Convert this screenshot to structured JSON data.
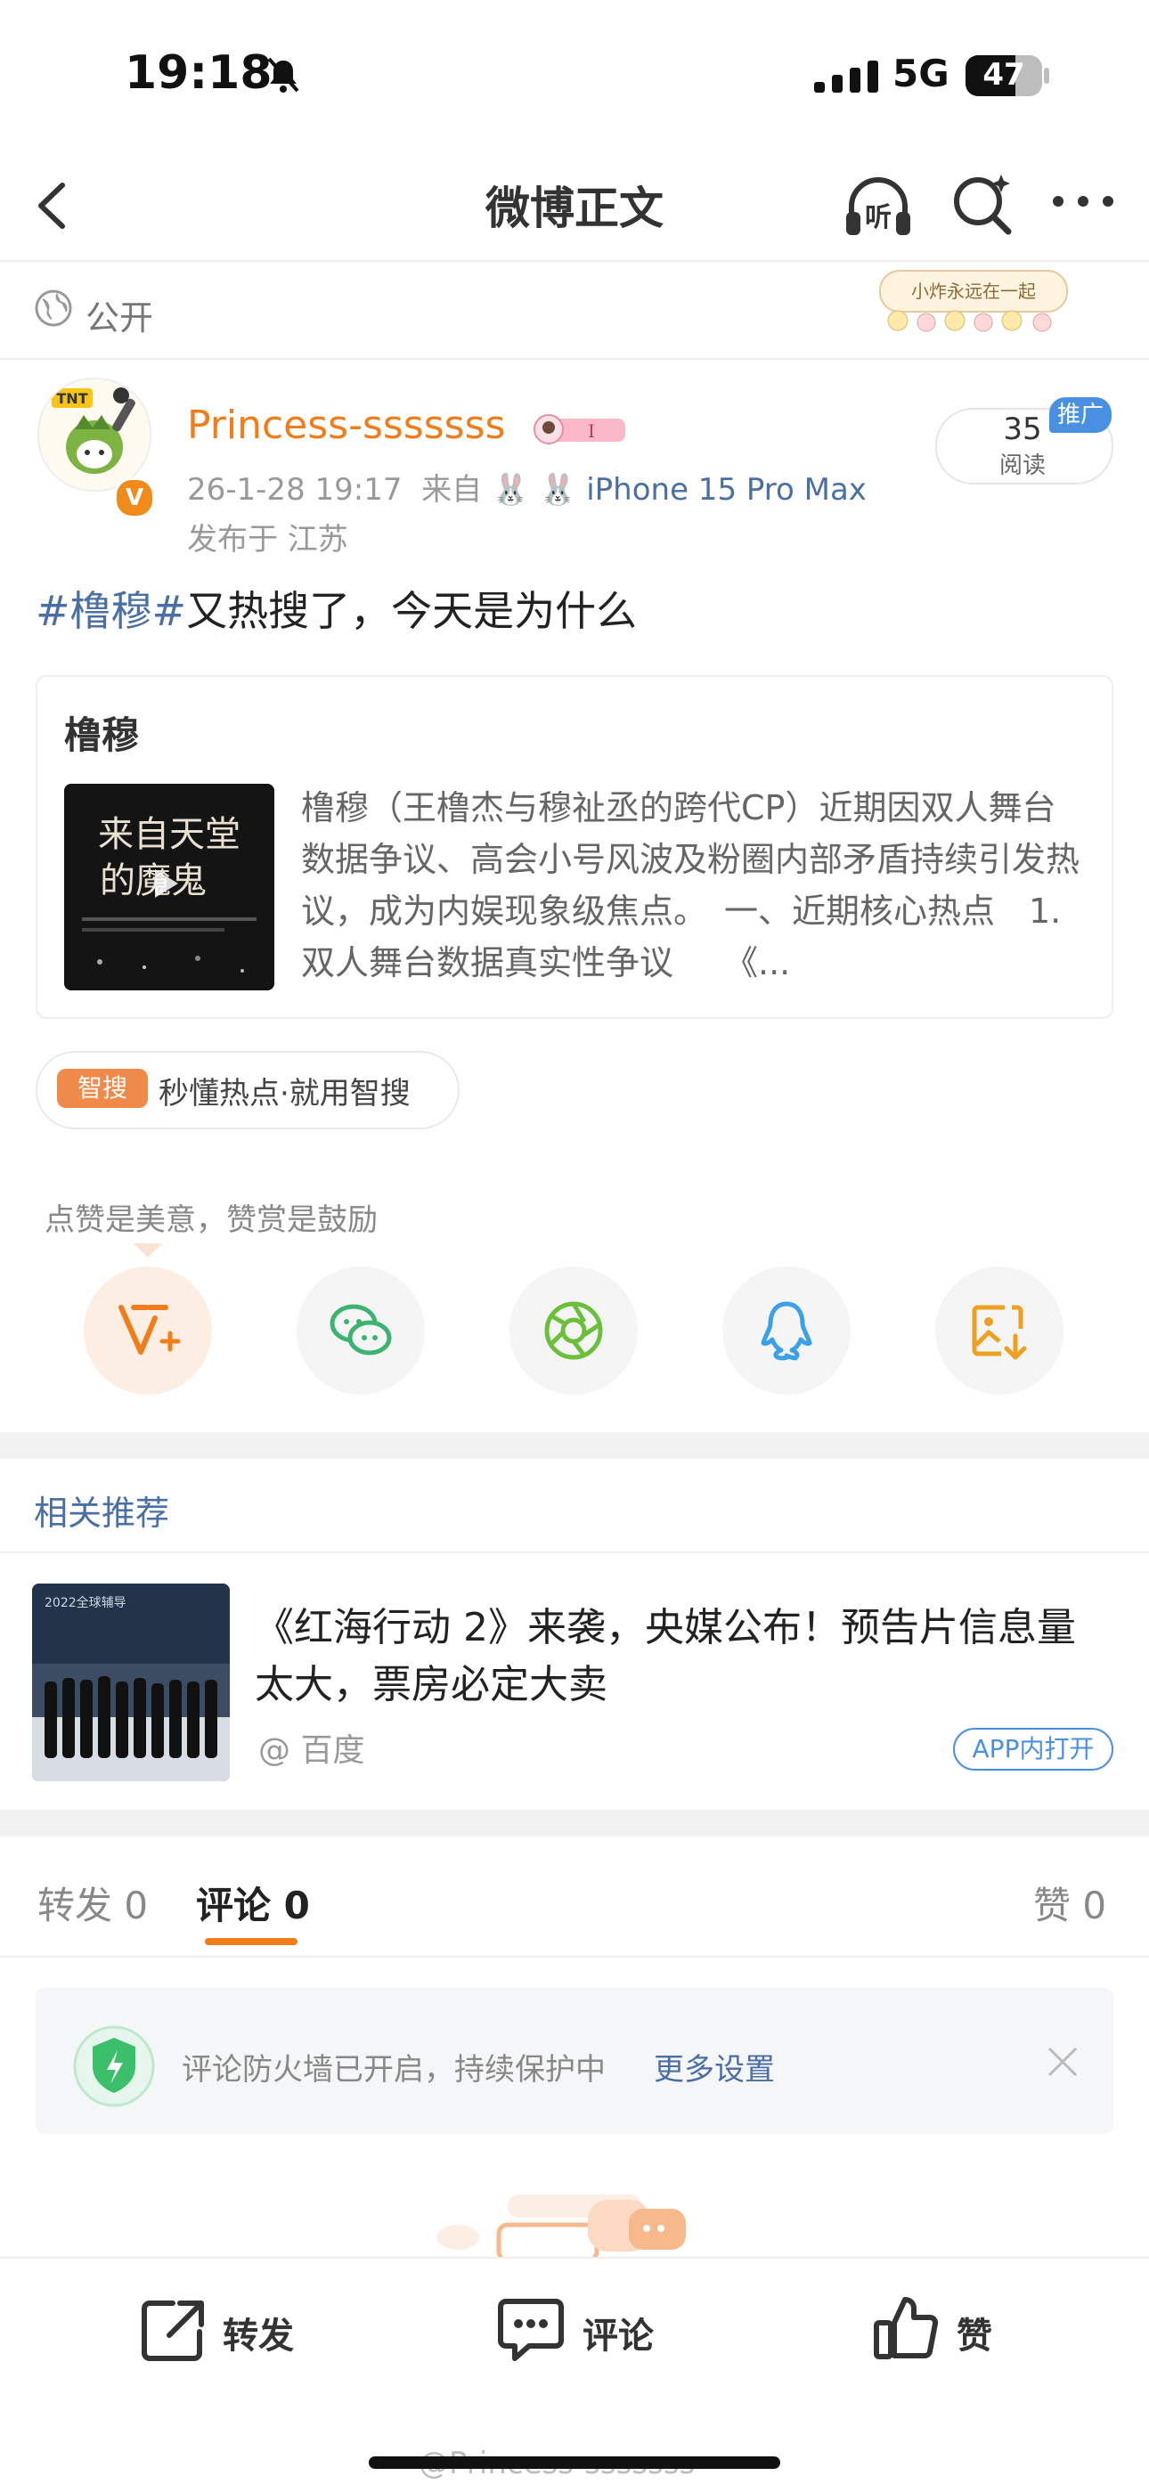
{
  "status_bar": {
    "time": "19:18",
    "network": "5G",
    "battery": "47"
  },
  "nav": {
    "title": "微博正文"
  },
  "visibility": {
    "label": "公开",
    "sticker_text": "小炸永远在一起"
  },
  "post": {
    "username": "Princess-sssssss",
    "badge_text": "I",
    "meta_time": "26-1-28 19:17",
    "meta_from": "来自",
    "device": "iPhone 15 Pro Max",
    "location": "发布于 江苏",
    "reads": "35",
    "reads_label": "阅读",
    "promo": "推广",
    "hashtag": "#橹穆#",
    "text": "又热搜了，今天是为什么"
  },
  "card": {
    "title": "橹穆",
    "image_title": "来自天堂的魔鬼",
    "description": "橹穆（王橹杰与穆祉丞的跨代CP）近期因双人舞台数据争议、高会小号风波及粉圈内部矛盾持续引发热议，成为内娱现象级焦点。　一、近期核心热点　1. 双人舞台数据真实性争议　　《..."
  },
  "smart_search": {
    "tag": "智搜",
    "text": "秒懂热点·就用智搜"
  },
  "like_hint": "点赞是美意，赞赏是鼓励",
  "share_icons": [
    "v-plus-icon",
    "wechat-icon",
    "moments-icon",
    "qq-icon",
    "save-image-icon"
  ],
  "related": {
    "section_title": "相关推荐",
    "title": "《红海行动 2》来袭，央媒公布！预告片信息量太大，票房必定大卖",
    "source": "@ 百度",
    "open_label": "APP内打开"
  },
  "tabs": {
    "repost": "转发 0",
    "comment": "评论 0",
    "like": "赞 0"
  },
  "firewall": {
    "text": "评论防火墙已开启，持续保护中",
    "link": "更多设置"
  },
  "bottom_bar": {
    "repost": "转发",
    "comment": "评论",
    "like": "赞"
  },
  "watermark": "@Princess-sssssss",
  "colors": {
    "accent": "#f07d1a",
    "link": "#4a6fa5",
    "blue": "#4a90e2"
  }
}
